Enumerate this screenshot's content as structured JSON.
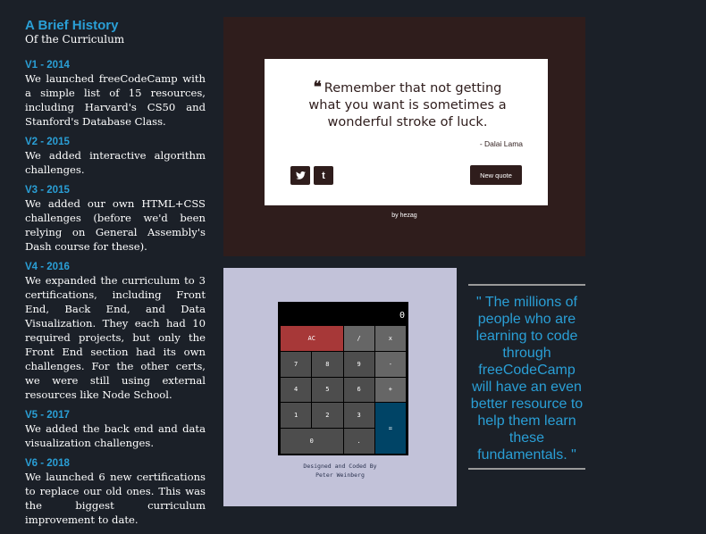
{
  "history": {
    "title": "A Brief History",
    "subtitle": "Of the Curriculum",
    "entries": [
      {
        "version": "V1 - 2014",
        "text": "We launched freeCodeCamp with a simple list of 15 resources, including Harvard's CS50 and Stanford's Database Class."
      },
      {
        "version": "V2 - 2015",
        "text": "We added interactive algorithm challenges."
      },
      {
        "version": "V3 - 2015",
        "text": "We added our own HTML+CSS challenges (before we'd been relying on General Assembly's Dash course for these)."
      },
      {
        "version": "V4 - 2016",
        "text": "We expanded the curriculum to 3 certifications, including Front End, Back End, and Data Visualization. They each had 10 required projects, but only the Front End section had its own challenges. For the other certs, we were still using external resources like Node School."
      },
      {
        "version": "V5 - 2017",
        "text": "We added the back end and data visualization challenges."
      },
      {
        "version": "V6 - 2018",
        "text": "We launched 6 new certifications to replace our old ones. This was the biggest curriculum improvement to date."
      }
    ]
  },
  "quote_machine": {
    "quote": "Remember that not getting what you want is sometimes a wonderful stroke of luck.",
    "author": "- Dalai Lama",
    "twitter_label": "t",
    "tumblr_label": "t",
    "new_quote_label": "New quote",
    "byline": "by hezag",
    "colors": {
      "theme": "#2f1d1c",
      "card": "#ffffff"
    }
  },
  "calculator": {
    "display": "0",
    "keys": {
      "ac": "AC",
      "divide": "/",
      "multiply": "x",
      "seven": "7",
      "eight": "8",
      "nine": "9",
      "subtract": "-",
      "four": "4",
      "five": "5",
      "six": "6",
      "add": "+",
      "one": "1",
      "two": "2",
      "three": "3",
      "equals": "=",
      "zero": "0",
      "decimal": "."
    },
    "credit_line1": "Designed and Coded By",
    "credit_line2": "Peter Weinberg",
    "colors": {
      "ac": "#a73838",
      "equals": "#004466",
      "key": "#4d4d4d",
      "operator": "#666666",
      "panel": "#c2c2d9"
    }
  },
  "mission_quote": {
    "text": "\" The millions of people who are learning to code through freeCodeCamp will have an even better resource to help them learn these fundamentals. \"",
    "color": "#2a9fd6"
  }
}
